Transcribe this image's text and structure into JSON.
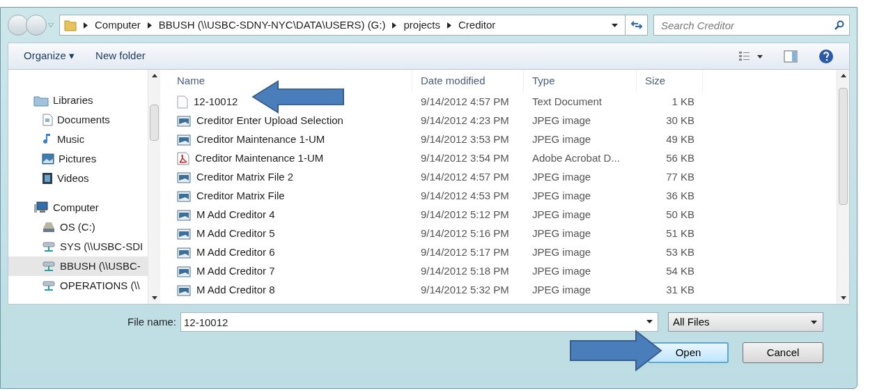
{
  "breadcrumb": {
    "segments": [
      "Computer",
      "BBUSH (\\\\USBC-SDNY-NYC\\DATA\\USERS) (G:)",
      "projects",
      "Creditor"
    ]
  },
  "search": {
    "placeholder": "Search Creditor"
  },
  "toolbar": {
    "buttons": [
      "Organize ▾",
      "New folder"
    ]
  },
  "sidebar": {
    "items": [
      {
        "label": "Libraries",
        "kind": "library",
        "selected": false,
        "children": [
          {
            "label": "Documents",
            "kind": "document",
            "selected": false
          },
          {
            "label": "Music",
            "kind": "music",
            "selected": false
          },
          {
            "label": "Pictures",
            "kind": "picture",
            "selected": false
          },
          {
            "label": "Videos",
            "kind": "video",
            "selected": false
          }
        ]
      },
      {
        "label": "Computer",
        "kind": "computer",
        "selected": false,
        "children": [
          {
            "label": "OS (C:)",
            "kind": "drive",
            "selected": false
          },
          {
            "label": "SYS (\\\\USBC-SDI",
            "kind": "network",
            "selected": false
          },
          {
            "label": "BBUSH (\\\\USBC-",
            "kind": "network",
            "selected": true
          },
          {
            "label": "OPERATIONS (\\\\",
            "kind": "network",
            "selected": false
          }
        ]
      }
    ]
  },
  "table": {
    "columns": [
      "Name",
      "Date modified",
      "Type",
      "Size"
    ],
    "rows": [
      {
        "kind": "text",
        "name": "12-10012",
        "date": "9/14/2012 4:57 PM",
        "type": "Text Document",
        "size": "1 KB"
      },
      {
        "kind": "image",
        "name": "Creditor Enter Upload Selection",
        "date": "9/14/2012 4:23 PM",
        "type": "JPEG image",
        "size": "30 KB"
      },
      {
        "kind": "image",
        "name": "Creditor Maintenance 1-UM",
        "date": "9/14/2012 3:53 PM",
        "type": "JPEG image",
        "size": "49 KB"
      },
      {
        "kind": "pdf",
        "name": "Creditor Maintenance 1-UM",
        "date": "9/14/2012 3:54 PM",
        "type": "Adobe Acrobat D...",
        "size": "56 KB"
      },
      {
        "kind": "image",
        "name": "Creditor Matrix File 2",
        "date": "9/14/2012 4:57 PM",
        "type": "JPEG image",
        "size": "77 KB"
      },
      {
        "kind": "image",
        "name": "Creditor Matrix File",
        "date": "9/14/2012 4:53 PM",
        "type": "JPEG image",
        "size": "36 KB"
      },
      {
        "kind": "image",
        "name": "M Add Creditor 4",
        "date": "9/14/2012 5:12 PM",
        "type": "JPEG image",
        "size": "50 KB"
      },
      {
        "kind": "image",
        "name": "M Add Creditor 5",
        "date": "9/14/2012 5:16 PM",
        "type": "JPEG image",
        "size": "51 KB"
      },
      {
        "kind": "image",
        "name": "M Add Creditor 6",
        "date": "9/14/2012 5:17 PM",
        "type": "JPEG image",
        "size": "53 KB"
      },
      {
        "kind": "image",
        "name": "M Add Creditor 7",
        "date": "9/14/2012 5:18 PM",
        "type": "JPEG image",
        "size": "54 KB"
      },
      {
        "kind": "image",
        "name": "M Add Creditor 8",
        "date": "9/14/2012 5:32 PM",
        "type": "JPEG image",
        "size": "31 KB"
      }
    ]
  },
  "file_name": {
    "label": "File name:",
    "value": "12-10012"
  },
  "file_type": {
    "value": "All Files"
  },
  "buttons": [
    {
      "label": "Open",
      "kind": "primary"
    },
    {
      "label": "Cancel",
      "kind": "normal"
    }
  ]
}
